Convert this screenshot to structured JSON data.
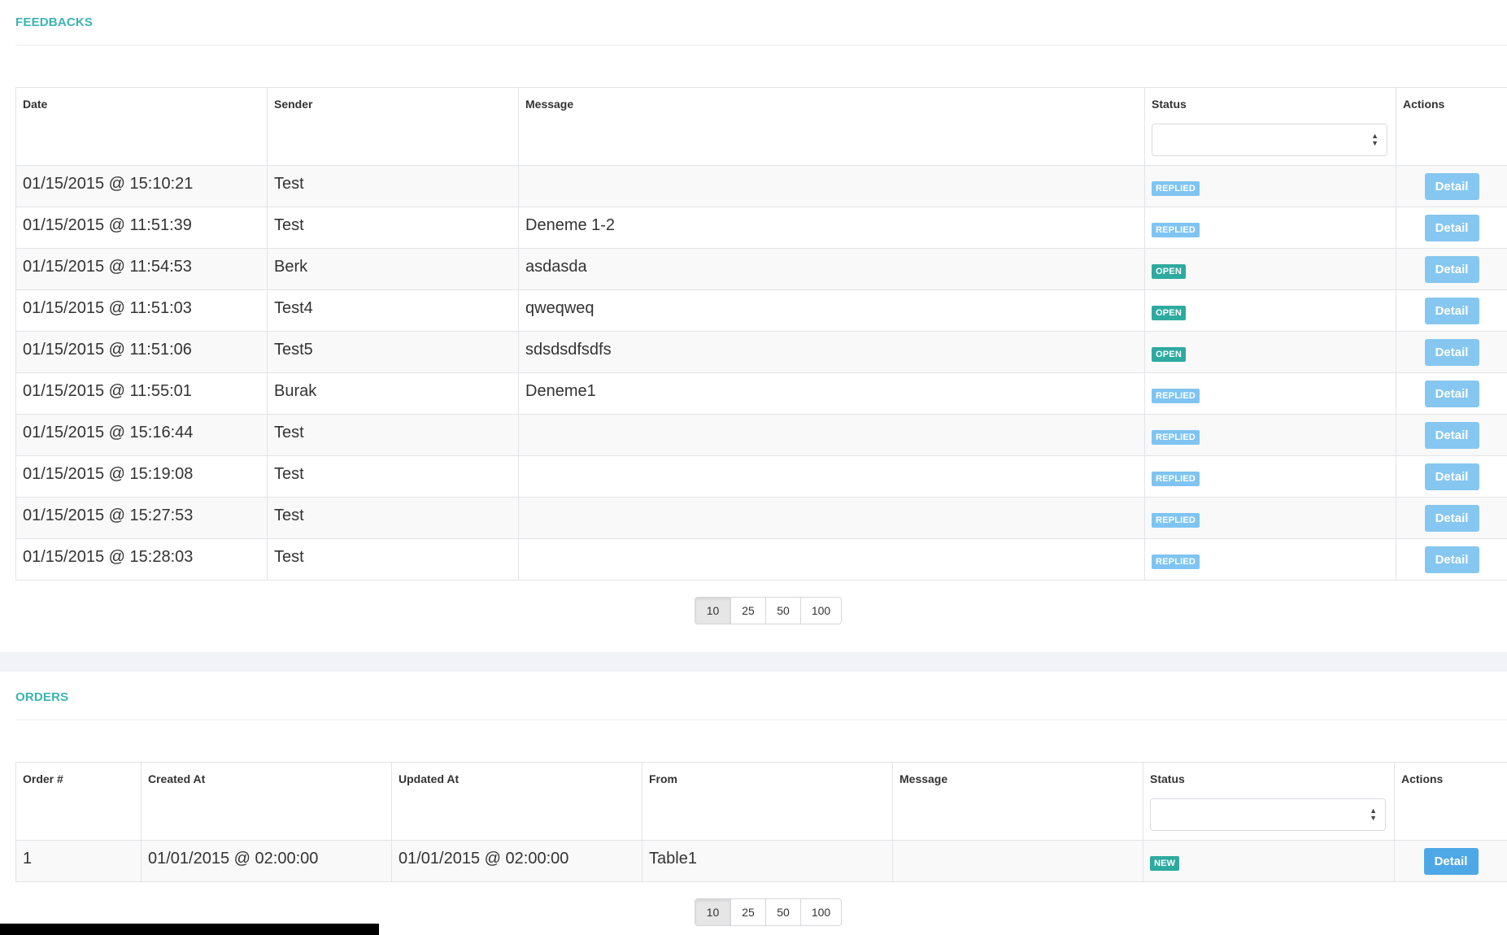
{
  "feedbacks": {
    "title": "FEEDBACKS",
    "columns": {
      "date": "Date",
      "sender": "Sender",
      "message": "Message",
      "status": "Status",
      "actions": "Actions"
    },
    "status_filter_value": "",
    "rows": [
      {
        "date": "01/15/2015 @ 15:10:21",
        "sender": "Test",
        "message": "",
        "status": "REPLIED",
        "action": "Detail"
      },
      {
        "date": "01/15/2015 @ 11:51:39",
        "sender": "Test",
        "message": "Deneme 1-2",
        "status": "REPLIED",
        "action": "Detail"
      },
      {
        "date": "01/15/2015 @ 11:54:53",
        "sender": "Berk",
        "message": "asdasda",
        "status": "OPEN",
        "action": "Detail"
      },
      {
        "date": "01/15/2015 @ 11:51:03",
        "sender": "Test4",
        "message": "qweqweq",
        "status": "OPEN",
        "action": "Detail"
      },
      {
        "date": "01/15/2015 @ 11:51:06",
        "sender": "Test5",
        "message": "sdsdsdfsdfs",
        "status": "OPEN",
        "action": "Detail"
      },
      {
        "date": "01/15/2015 @ 11:55:01",
        "sender": "Burak",
        "message": "Deneme1",
        "status": "REPLIED",
        "action": "Detail"
      },
      {
        "date": "01/15/2015 @ 15:16:44",
        "sender": "Test",
        "message": "",
        "status": "REPLIED",
        "action": "Detail"
      },
      {
        "date": "01/15/2015 @ 15:19:08",
        "sender": "Test",
        "message": "",
        "status": "REPLIED",
        "action": "Detail"
      },
      {
        "date": "01/15/2015 @ 15:27:53",
        "sender": "Test",
        "message": "",
        "status": "REPLIED",
        "action": "Detail"
      },
      {
        "date": "01/15/2015 @ 15:28:03",
        "sender": "Test",
        "message": "",
        "status": "REPLIED",
        "action": "Detail"
      }
    ],
    "page_sizes": [
      "10",
      "25",
      "50",
      "100"
    ],
    "active_page_size": "10"
  },
  "orders": {
    "title": "ORDERS",
    "columns": {
      "order_no": "Order #",
      "created_at": "Created At",
      "updated_at": "Updated At",
      "from": "From",
      "message": "Message",
      "status": "Status",
      "actions": "Actions"
    },
    "status_filter_value": "",
    "rows": [
      {
        "order_no": "1",
        "created_at": "01/01/2015 @ 02:00:00",
        "updated_at": "01/01/2015 @ 02:00:00",
        "from": "Table1",
        "message": "",
        "status": "NEW",
        "action": "Detail"
      }
    ],
    "page_sizes": [
      "10",
      "25",
      "50",
      "100"
    ],
    "active_page_size": "10"
  },
  "colors": {
    "section_title": "#3bb4b0",
    "badge_replied": "#7fc4f2",
    "badge_open": "#2eaaa0",
    "button": "#85c7f0"
  },
  "icons": {
    "select_arrows": "up-down-arrows-icon"
  }
}
